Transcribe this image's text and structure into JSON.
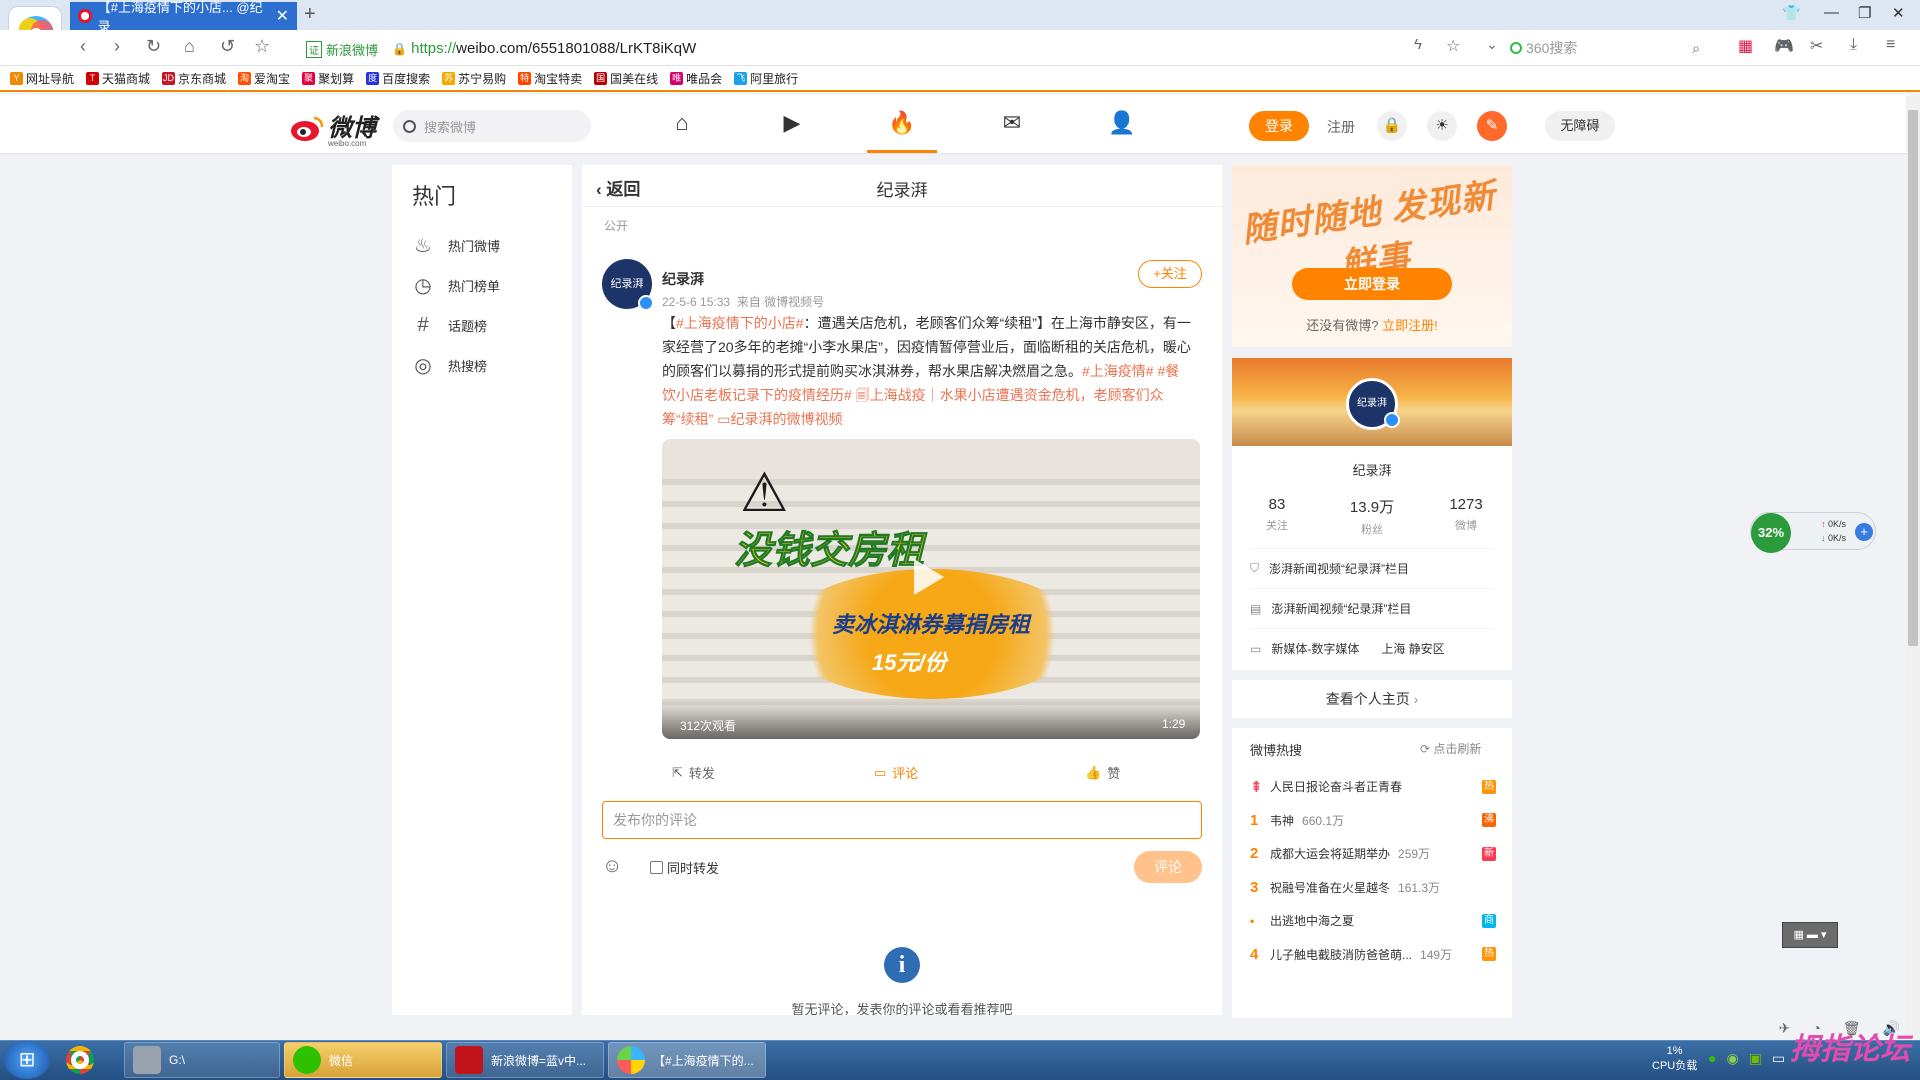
{
  "browser": {
    "tab_title": "【#上海疫情下的小店... @纪录",
    "tab_close": "✕",
    "new_tab": "+",
    "site_badge": "证",
    "site_name": "新浪微博",
    "url_scheme": "https://",
    "url_rest": "weibo.com/6551801088/LrKT8iKqW",
    "search_placeholder": "360搜索",
    "bookmarks": [
      {
        "label": "网址导航",
        "color": "#f08a00",
        "glyph": "Y"
      },
      {
        "label": "天猫商城",
        "color": "#d40000",
        "glyph": "T"
      },
      {
        "label": "京东商城",
        "color": "#c91623",
        "glyph": "JD"
      },
      {
        "label": "爱淘宝",
        "color": "#ff5000",
        "glyph": "淘"
      },
      {
        "label": "聚划算",
        "color": "#e60040",
        "glyph": "聚"
      },
      {
        "label": "百度搜索",
        "color": "#2932e1",
        "glyph": "度"
      },
      {
        "label": "苏宁易购",
        "color": "#f5a800",
        "glyph": "苏"
      },
      {
        "label": "淘宝特卖",
        "color": "#ff4400",
        "glyph": "特"
      },
      {
        "label": "国美在线",
        "color": "#b80000",
        "glyph": "国"
      },
      {
        "label": "唯品会",
        "color": "#d6006b",
        "glyph": "唯"
      },
      {
        "label": "阿里旅行",
        "color": "#1aa0e6",
        "glyph": "飞"
      }
    ]
  },
  "weibo_header": {
    "logo_text": "微博",
    "logo_sub": "weibo.com",
    "search_placeholder": "搜索微博",
    "login": "登录",
    "register": "注册",
    "accessibility": "无障碍"
  },
  "left_nav": {
    "title": "热门",
    "items": [
      {
        "label": "热门微博",
        "icon": "flame-outline-icon"
      },
      {
        "label": "热门榜单",
        "icon": "clock-icon"
      },
      {
        "label": "话题榜",
        "icon": "hash-icon"
      },
      {
        "label": "热搜榜",
        "icon": "search-circle-icon"
      }
    ]
  },
  "feed": {
    "back": "返回",
    "title": "纪录湃",
    "visibility": "公开",
    "author": "纪录湃",
    "avatar_text": "纪录湃",
    "time": "22-5-6 15:33",
    "source": "来自 微博视频号",
    "follow": "+关注",
    "text_parts": [
      {
        "t": "【",
        "hl": false
      },
      {
        "t": "#上海疫情下的小店#",
        "hl": true
      },
      {
        "t": "：遭遇关店危机，老顾客们众筹“续租”】在上海市静安区，有一家经营了20多年的老摊“小李水果店”，因疫情暂停营业后，面临断租的关店危机，暖心的顾客们以募捐的形式提前购买冰淇淋券，帮水果店解决燃眉之急。",
        "hl": false
      },
      {
        "t": "#上海疫情#",
        "hl": true
      },
      {
        "t": " ",
        "hl": false
      },
      {
        "t": "#餐饮小店老板记录下的疫情经历#",
        "hl": true
      },
      {
        "t": " 🗐上海战疫｜水果小店遭遇资金危机，老顾客们众筹“续租”",
        "hl": true
      },
      {
        "t": " ▭纪录湃的微博视频",
        "hl": true
      }
    ],
    "video": {
      "title": "没钱交房租",
      "sub1": "卖冰淇淋券募捐房租",
      "sub2": "15元/份",
      "views": "312次观看",
      "duration": "1:29"
    },
    "actions": {
      "repost": "转发",
      "comment": "评论",
      "like": "赞"
    },
    "comment_placeholder": "发布你的评论",
    "also_repost": "同时转发",
    "comment_btn": "评论",
    "info_glyph": "i",
    "no_comments": "暂无评论，发表你的评论或看看推荐吧"
  },
  "right": {
    "slogan": "随时随地 发现新鲜事",
    "login_now": "立即登录",
    "no_account": "还没有微博?",
    "register_now": "立即注册!",
    "profile": {
      "name": "纪录湃",
      "avatar_text": "纪录湃",
      "stats": [
        {
          "n": "83",
          "l": "关注"
        },
        {
          "n": "13.9万",
          "l": "粉丝"
        },
        {
          "n": "1273",
          "l": "微博"
        }
      ],
      "rows": [
        {
          "icon": "shield-icon",
          "text": "澎湃新闻视频“纪录湃”栏目"
        },
        {
          "icon": "doc-icon",
          "text": "澎湃新闻视频“纪录湃”栏目"
        },
        {
          "icon": "card-icon",
          "text": "新媒体-数字媒体",
          "extra": "上海 静安区"
        }
      ]
    },
    "view_home": "查看个人主页",
    "hot": {
      "title": "微博热搜",
      "refresh": "点击刷新",
      "items": [
        {
          "rank": "⇞",
          "text": "人民日报论奋斗者正青春",
          "heat": "",
          "tag": "热",
          "tag_color": "#ff9406"
        },
        {
          "rank": "1",
          "text": "韦神",
          "heat": "660.1万",
          "tag": "沸",
          "tag_color": "#f86400"
        },
        {
          "rank": "2",
          "text": "成都大运会将延期举办",
          "heat": "259万",
          "tag": "新",
          "tag_color": "#ff3852"
        },
        {
          "rank": "3",
          "text": "祝融号准备在火星越冬",
          "heat": "161.3万",
          "tag": "",
          "tag_color": ""
        },
        {
          "rank": "•",
          "text": "出逃地中海之夏",
          "heat": "",
          "tag": "商",
          "tag_color": "#00b7ee"
        },
        {
          "rank": "4",
          "text": "儿子触电截肢消防爸爸萌...",
          "heat": "149万",
          "tag": "热",
          "tag_color": "#ff9406"
        }
      ]
    }
  },
  "widgets": {
    "cpu_percent": "32%",
    "net_up": "0K/s",
    "net_down": "0K/s"
  },
  "taskbar": {
    "items": [
      {
        "label": "",
        "icon_color": "#e34133"
      },
      {
        "label": "G:\\",
        "icon_color": "#9aa3ad"
      },
      {
        "label": "微信",
        "icon_color": "#2dc100"
      },
      {
        "label": "新浪微博=蓝v中...",
        "icon_color": "#c0141a"
      },
      {
        "label": "【#上海疫情下的...",
        "icon_color": "#f5a300"
      }
    ],
    "cpu_value": "1%",
    "cpu_label": "CPU负载",
    "watermark": "拇指论坛"
  }
}
